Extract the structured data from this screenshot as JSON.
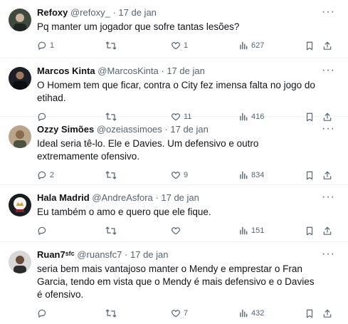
{
  "tweets": [
    {
      "name": "Refoxy",
      "handle": "@refoxy_",
      "separator": "·",
      "date": "17 de jan",
      "text": "Pq manter um jogador que sofre tantas lesões?",
      "replies": "1",
      "retweets": "",
      "likes": "1",
      "views": "627"
    },
    {
      "name": "Marcos Kinta",
      "handle": "@MarcosKinta",
      "separator": "·",
      "date": "17 de jan",
      "text": "O Homem tem que ficar, contra o City fez imensa falta no jogo do etihad.",
      "replies": "",
      "retweets": "",
      "likes": "11",
      "views": "416"
    },
    {
      "name": "Ozzy Simões",
      "handle": "@ozeiassimoes",
      "separator": "·",
      "date": "17 de jan",
      "text": "Ideal seria tê-lo. Ele e Davies. Um defensivo e outro extremamente ofensivo.",
      "replies": "2",
      "retweets": "",
      "likes": "9",
      "views": "834"
    },
    {
      "name": "Hala Madrid",
      "handle": "@AndreAsfora",
      "separator": "·",
      "date": "17 de jan",
      "text": "Eu também o amo e quero que ele fique.",
      "replies": "",
      "retweets": "",
      "likes": "",
      "views": "151"
    },
    {
      "name": "Ruan7ˢᶠᶜ",
      "handle": "@ruansfc7",
      "separator": "·",
      "date": "17 de jan",
      "text": "seria bem mais vantajoso manter o Mendy e emprestar o Fran Garcia, tendo em vista que o Mendy é mais defensivo e o Davies é ofensivo.",
      "replies": "",
      "retweets": "",
      "likes": "7",
      "views": "432"
    }
  ],
  "more_label": "···",
  "colors": {
    "text": "#0f1419",
    "muted": "#536471",
    "border": "#eff3f4"
  },
  "icons": [
    "reply-icon",
    "retweet-icon",
    "like-icon",
    "views-icon",
    "bookmark-icon",
    "share-icon"
  ]
}
